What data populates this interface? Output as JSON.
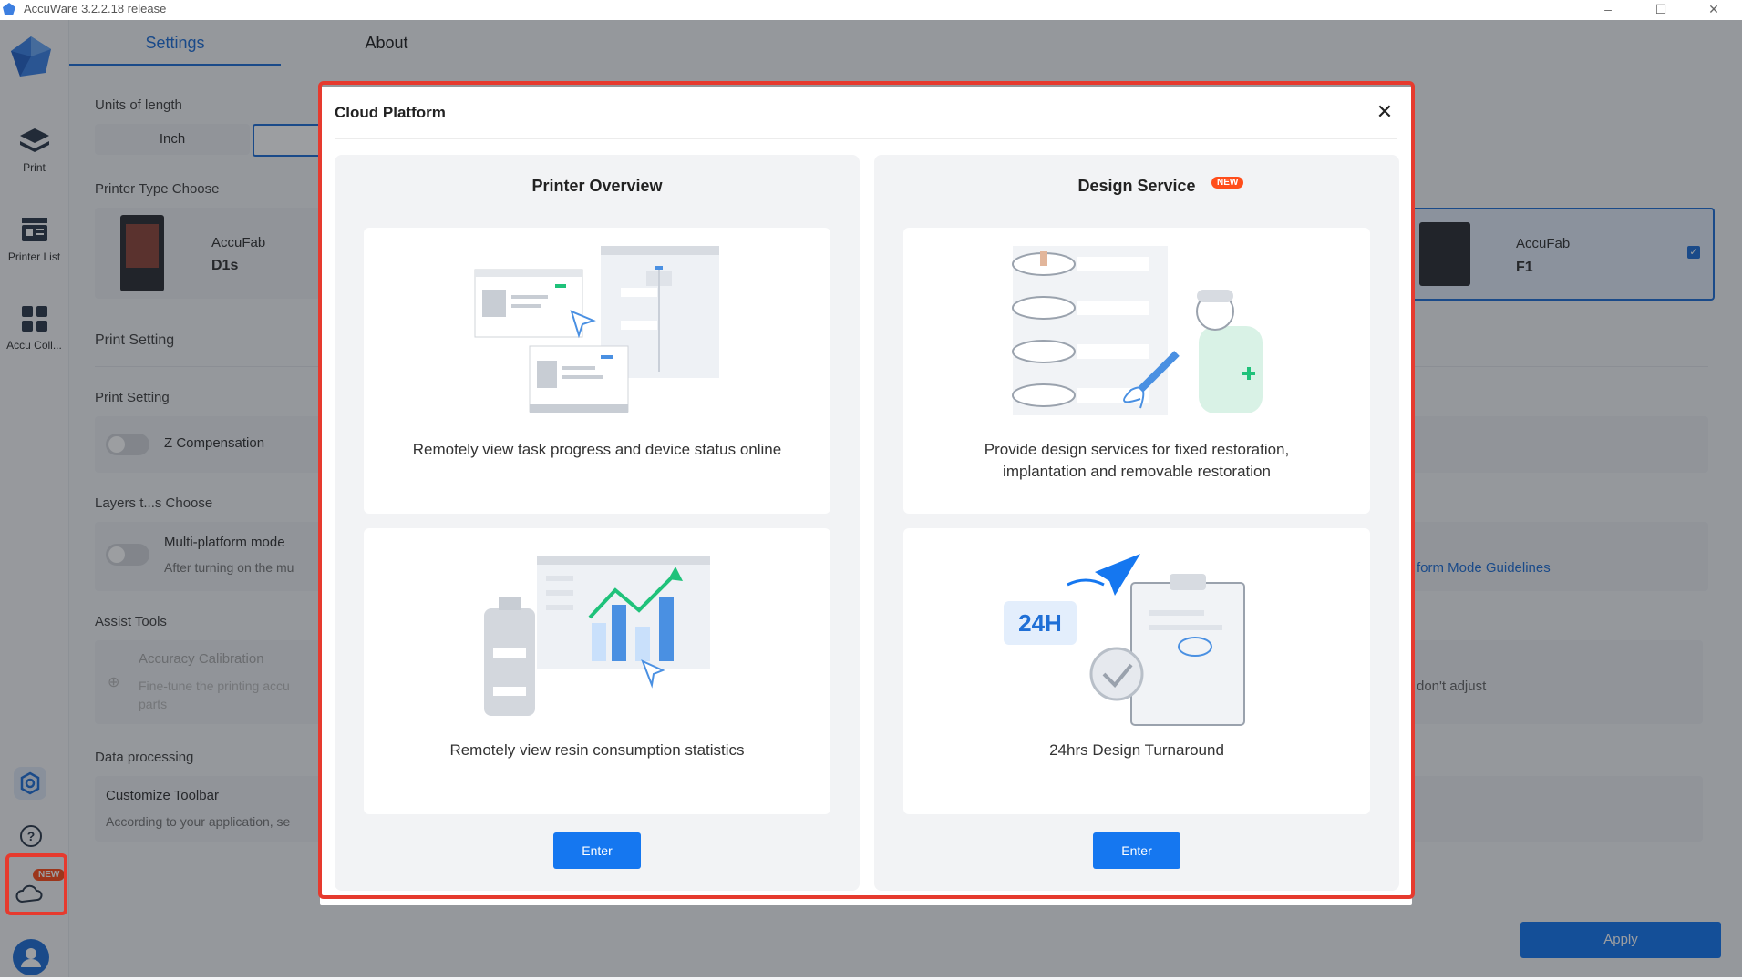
{
  "window": {
    "title": "AccuWare 3.2.2.18 release",
    "controls": [
      "–",
      "☐",
      "✕"
    ]
  },
  "sidebar": {
    "items": [
      {
        "label": "Print",
        "icon": "layers-icon"
      },
      {
        "label": "Printer List",
        "icon": "printer-list-icon"
      },
      {
        "label": "Accu Coll...",
        "icon": "grid-icon"
      }
    ],
    "bottom_icons": [
      "settings-icon",
      "help-icon",
      "cloud-icon",
      "user-avatar-icon"
    ],
    "cloud_badge": "NEW"
  },
  "tabs": [
    {
      "label": "Settings"
    },
    {
      "label": "About"
    }
  ],
  "settings": {
    "units_label": "Units of length",
    "units_option": "Inch",
    "printer_type_label": "Printer Type Choose",
    "printer_left": {
      "brand": "AccuFab",
      "model": "D1s"
    },
    "printer_right": {
      "brand": "AccuFab",
      "model": "F1"
    },
    "print_setting_header": "Print Setting",
    "print_setting_sub": "Print Setting",
    "z_comp": "Z Compensation",
    "layers_label": "Layers t...s Choose",
    "multi_platform": "Multi-platform mode",
    "multi_platform_desc": "After turning on the mu",
    "platform_guidelines": "form Mode Guidelines",
    "assist_tools": "Assist Tools",
    "accuracy_calibration": "Accuracy Calibration",
    "accuracy_desc_1": "Fine-tune the printing accu",
    "accuracy_desc_2": "parts",
    "dont_adjust": "don't adjust",
    "data_processing": "Data processing",
    "customize_toolbar": "Customize Toolbar",
    "customize_desc": "According to your application, se",
    "apply": "Apply"
  },
  "modal": {
    "title": "Cloud Platform",
    "close": "✕",
    "left": {
      "title": "Printer Overview",
      "feature1": "Remotely view task progress and device status online",
      "feature2": "Remotely view resin consumption statistics",
      "enter": "Enter"
    },
    "right": {
      "title": "Design Service",
      "badge": "NEW",
      "feature1_line1": "Provide design services for fixed restoration,",
      "feature1_line2": "implantation and removable restoration",
      "feature2": "24hrs Design Turnaround",
      "turnaround_badge": "24H",
      "enter": "Enter"
    }
  },
  "colors": {
    "accent": "#1577f0",
    "highlight": "#e63a2e",
    "badge": "#ff4d1a",
    "green": "#1fc27a"
  }
}
